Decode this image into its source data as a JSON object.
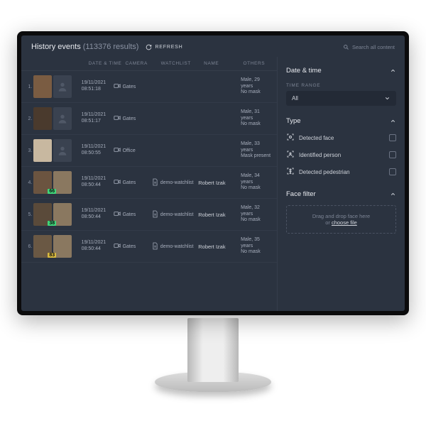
{
  "header": {
    "title": "History events",
    "count": "(113376 results)",
    "refresh": "REFRESH",
    "search_ph": "Search all content"
  },
  "columns": {
    "dt": "DATE & TIME",
    "cam": "CAMERA",
    "wl": "WATCHLIST",
    "nm": "NAME",
    "ot": "OTHERS"
  },
  "rows": [
    {
      "idx": "1.",
      "date": "19/11/2021",
      "time": "08:51:18",
      "cam": "Gates",
      "wl": "",
      "name": "",
      "g": "Male, 29 years",
      "m": "No mask",
      "match": null,
      "dual": false
    },
    {
      "idx": "2.",
      "date": "19/11/2021",
      "time": "08:51:17",
      "cam": "Gates",
      "wl": "",
      "name": "",
      "g": "Male, 31 years",
      "m": "No mask",
      "match": null,
      "dual": false
    },
    {
      "idx": "3.",
      "date": "19/11/2021",
      "time": "08:50:55",
      "cam": "Office",
      "wl": "",
      "name": "",
      "g": "Male, 33 years",
      "m": "Mask present",
      "match": null,
      "dual": false
    },
    {
      "idx": "4.",
      "date": "19/11/2021",
      "time": "08:50:44",
      "cam": "Gates",
      "wl": "demo-watchlist",
      "name": "Robert Izak",
      "g": "Male, 34 years",
      "m": "No mask",
      "match": "66",
      "mc": "g",
      "dual": true
    },
    {
      "idx": "5.",
      "date": "19/11/2021",
      "time": "08:50:44",
      "cam": "Gates",
      "wl": "demo-watchlist",
      "name": "Robert Izak",
      "g": "Male, 32 years",
      "m": "No mask",
      "match": "38",
      "mc": "g",
      "dual": true
    },
    {
      "idx": "6.",
      "date": "19/11/2021",
      "time": "08:50:44",
      "cam": "Gates",
      "wl": "demo-watchlist",
      "name": "Robert Izak",
      "g": "Male, 35 years",
      "m": "No mask",
      "match": "83",
      "mc": "y",
      "dual": true
    }
  ],
  "filters": {
    "date_time": "Date & time",
    "time_range_lbl": "TIME RANGE",
    "time_range_val": "All",
    "type": "Type",
    "type_opts": [
      "Detected face",
      "Identified person",
      "Detected pedestrian"
    ],
    "face_filter": "Face filter",
    "drop_txt": "Drag and drop face here",
    "drop_or": "or ",
    "drop_link": "choose file"
  }
}
